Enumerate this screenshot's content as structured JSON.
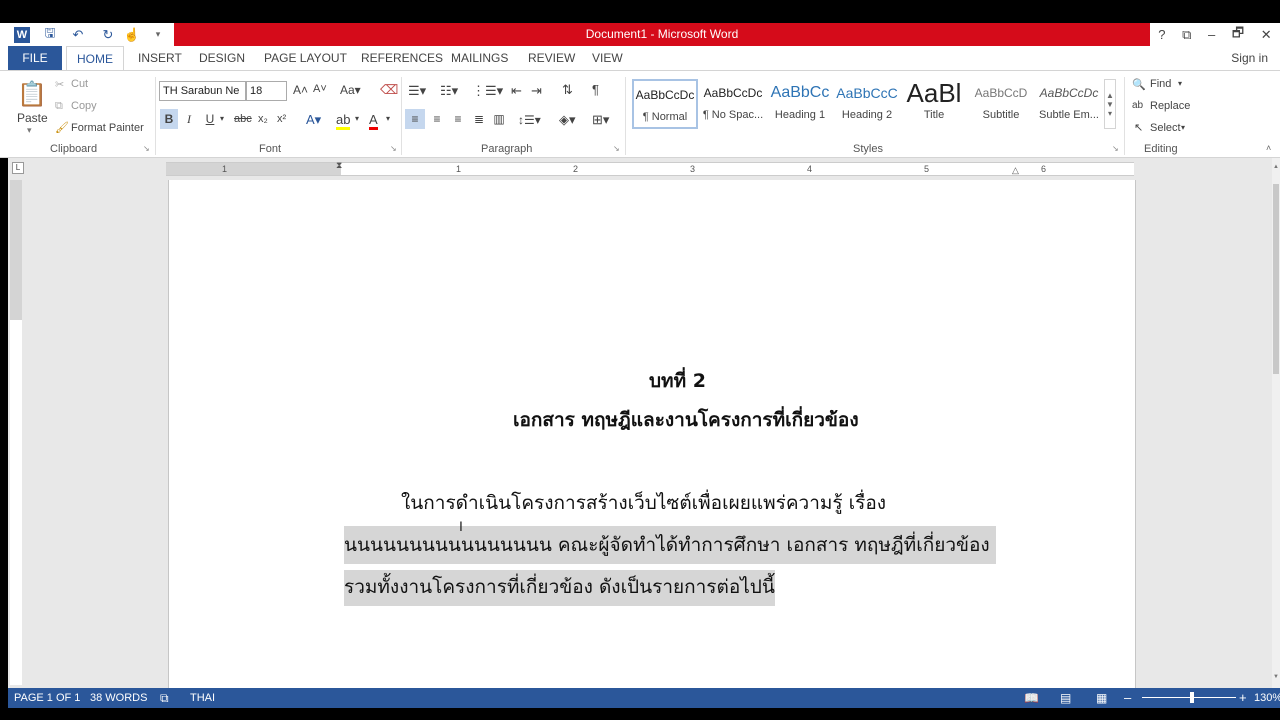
{
  "window": {
    "title": "Document1 -  Microsoft Word",
    "controls": [
      "?",
      "⧉",
      "–",
      "🗗",
      "✕"
    ]
  },
  "qat": {
    "icons": [
      "word-app-icon",
      "save-icon",
      "undo-icon",
      "redo-icon",
      "touch-mode-icon",
      "customize-qat-icon"
    ]
  },
  "tabs": [
    "FILE",
    "HOME",
    "INSERT",
    "DESIGN",
    "PAGE LAYOUT",
    "REFERENCES",
    "MAILINGS",
    "REVIEW",
    "VIEW"
  ],
  "account": {
    "sign_in": "Sign in"
  },
  "clipboard": {
    "paste": "Paste",
    "cut": "Cut",
    "copy": "Copy",
    "format_painter": "Format Painter",
    "label": "Clipboard"
  },
  "font": {
    "name": "TH Sarabun Ne",
    "size": "18",
    "label": "Font"
  },
  "paragraph": {
    "label": "Paragraph"
  },
  "styles": {
    "items": [
      {
        "preview": "AaBbCcDc",
        "name": "¶ Normal"
      },
      {
        "preview": "AaBbCcDc",
        "name": "¶ No Spac..."
      },
      {
        "preview": "AaBbCc",
        "name": "Heading 1"
      },
      {
        "preview": "AaBbCcC",
        "name": "Heading 2"
      },
      {
        "preview": "AaBl",
        "name": "Title"
      },
      {
        "preview": "AaBbCcD",
        "name": "Subtitle"
      },
      {
        "preview": "AaBbCcDc",
        "name": "Subtle Em..."
      }
    ],
    "label": "Styles"
  },
  "editing": {
    "find": "Find",
    "replace": "Replace",
    "select": "Select",
    "label": "Editing"
  },
  "ruler": {
    "numbers": [
      "1",
      "1",
      "2",
      "3",
      "4",
      "5",
      "6"
    ]
  },
  "document": {
    "chapter": "บทที่  2",
    "subtitle": "เอกสาร ทฤษฎีและงานโครงการที่เกี่ยวข้อง",
    "line1": "ในการดำเนินโครงการสร้างเว็บไซต์เพื่อเผยแพร่ความรู้ เรื่อง",
    "line2": "นนนนนนนนนนนนนนนน  คณะผู้จัดทำได้ทำการศึกษา เอกสาร ทฤษฎีที่เกี่ยวข้อง",
    "line3": "รวมทั้งงานโครงการที่เกี่ยวข้อง ดังเป็นรายการต่อไปนี้"
  },
  "status": {
    "page": "PAGE 1 OF 1",
    "words": "38 WORDS",
    "language": "THAI",
    "zoom": "130%"
  }
}
